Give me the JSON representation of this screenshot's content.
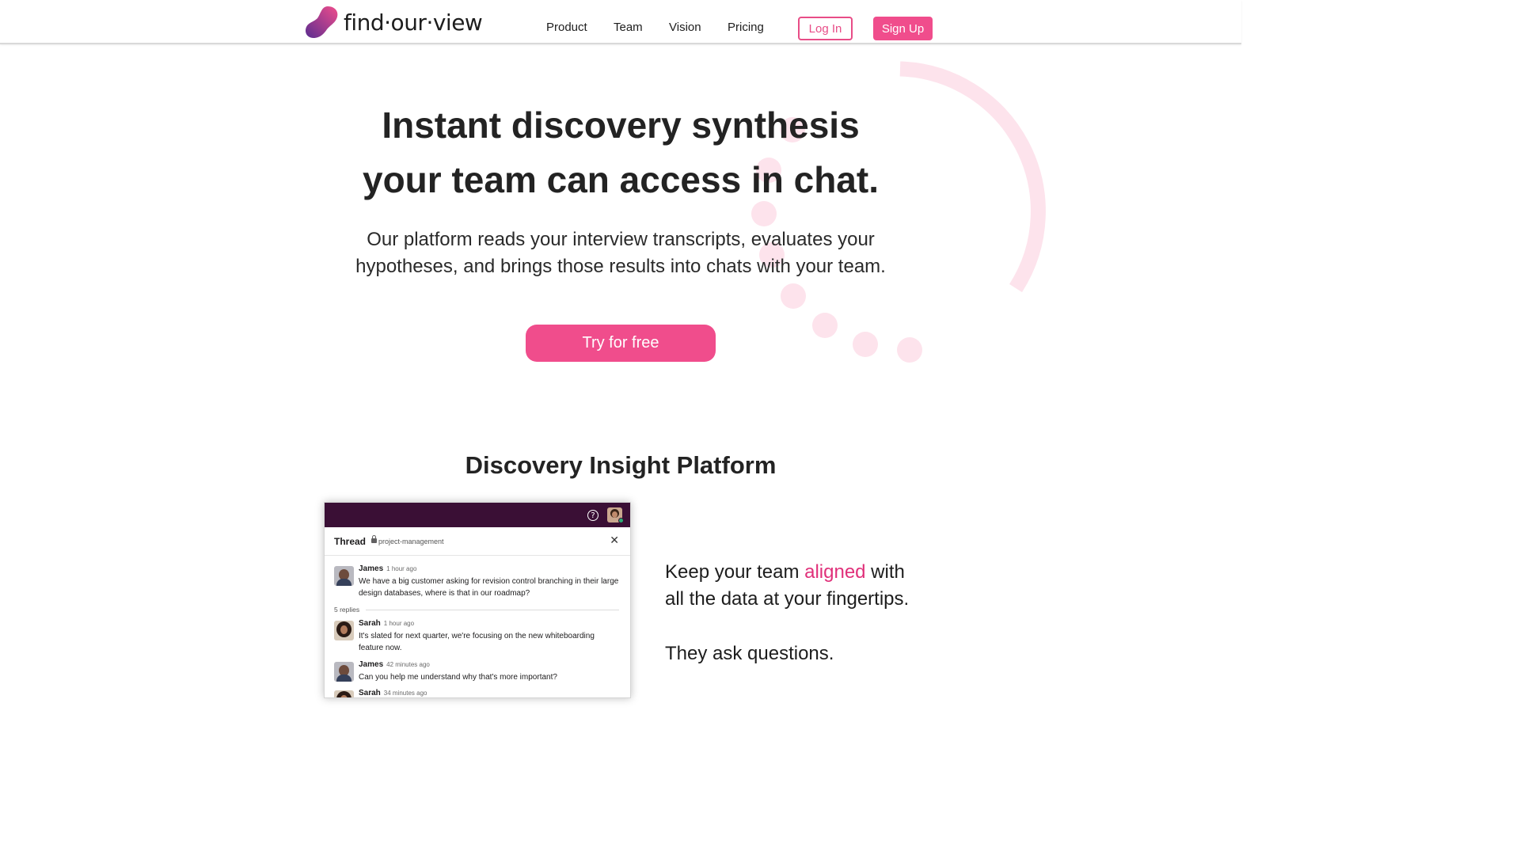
{
  "nav": {
    "brand": "find·our·view",
    "links": [
      "Product",
      "Team",
      "Vision",
      "Pricing"
    ],
    "login_label": "Log In",
    "signup_label": "Sign Up"
  },
  "hero": {
    "title_line1": "Instant discovery synthesis",
    "title_line2": "your team can access in chat.",
    "subtitle_line1": "Our platform reads your interview transcripts, evaluates your",
    "subtitle_line2": "hypotheses, and brings those results into chats with your team.",
    "cta_label": "Try for free"
  },
  "section": {
    "title": "Discovery Insight Platform"
  },
  "chat": {
    "help_symbol": "?",
    "thread_title": "Thread",
    "channel": "project-management",
    "close_symbol": "✕",
    "replies_label": "5 replies",
    "messages": [
      {
        "name": "James",
        "time": "1 hour ago",
        "text": "We have a big customer asking for revision control branching in their large design databases, where is that in our roadmap?"
      },
      {
        "name": "Sarah",
        "time": "1 hour ago",
        "text": "It's slated for next quarter, we're focusing on the new whiteboarding feature now."
      },
      {
        "name": "James",
        "time": "42 minutes ago",
        "text": "Can you help me understand why that's more important?"
      },
      {
        "name": "Sarah",
        "time": "34 minutes ago",
        "text": ""
      }
    ]
  },
  "copy": {
    "line_a_prefix": "Keep your team ",
    "line_a_accent": "aligned",
    "line_a_suffix": " with",
    "line_b": "all the data at your fingertips.",
    "line_c": "They ask questions."
  },
  "colors": {
    "brand_pink": "#f04d8c",
    "chat_header": "#3a0f35",
    "decor_pink": "#fde3ec"
  }
}
